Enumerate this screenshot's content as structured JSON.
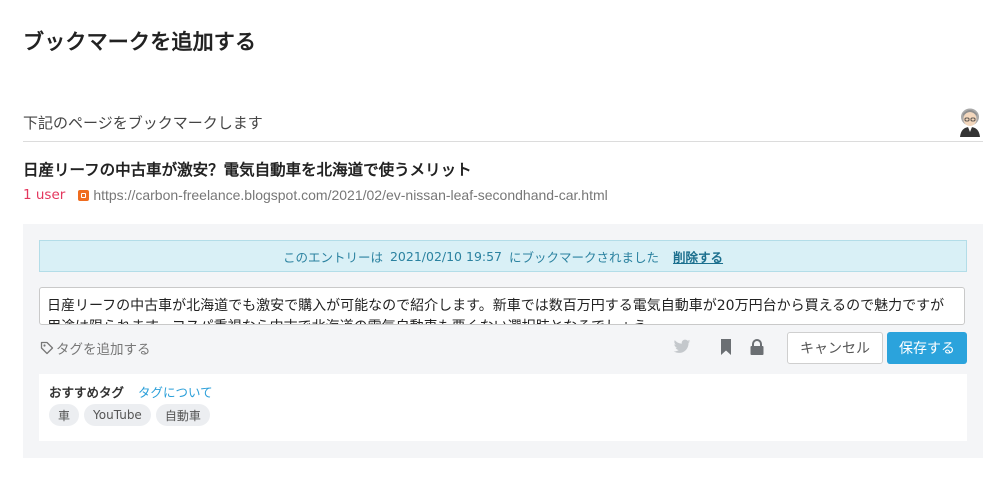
{
  "page": {
    "title": "ブックマークを追加する"
  },
  "section": {
    "header": "下記のページをブックマークします"
  },
  "entry": {
    "title": "日産リーフの中古車が激安？電気自動車を北海道で使うメリット",
    "users": "1 user",
    "url": "https://carbon-freelance.blogspot.com/2021/02/ev-nissan-leaf-secondhand-car.html"
  },
  "notice": {
    "prefix": "このエントリーは",
    "timestamp": "2021/02/10 19:57",
    "suffix": "にブックマークされました",
    "delete_label": "削除する"
  },
  "comment": {
    "value": "日産リーフの中古車が北海道でも激安で購入が可能なので紹介します。新車では数百万円する電気自動車が20万円台から買えるので魅力ですが用途は限られます。コスパ重視なら中古で北海道の電気自動車も悪くない選択肢となるでしょう。"
  },
  "toolbar": {
    "tag_add_label": "タグを追加する",
    "cancel_label": "キャンセル",
    "save_label": "保存する"
  },
  "recommend": {
    "label": "おすすめタグ",
    "about_label": "タグについて",
    "tags": [
      "車",
      "YouTube",
      "自動車"
    ]
  },
  "colors": {
    "accent": "#2ba3dc",
    "users": "#e4365d",
    "notice_bg": "#d9f0f6",
    "notice_text": "#2b82a0",
    "panel_bg": "#f4f5f7"
  }
}
